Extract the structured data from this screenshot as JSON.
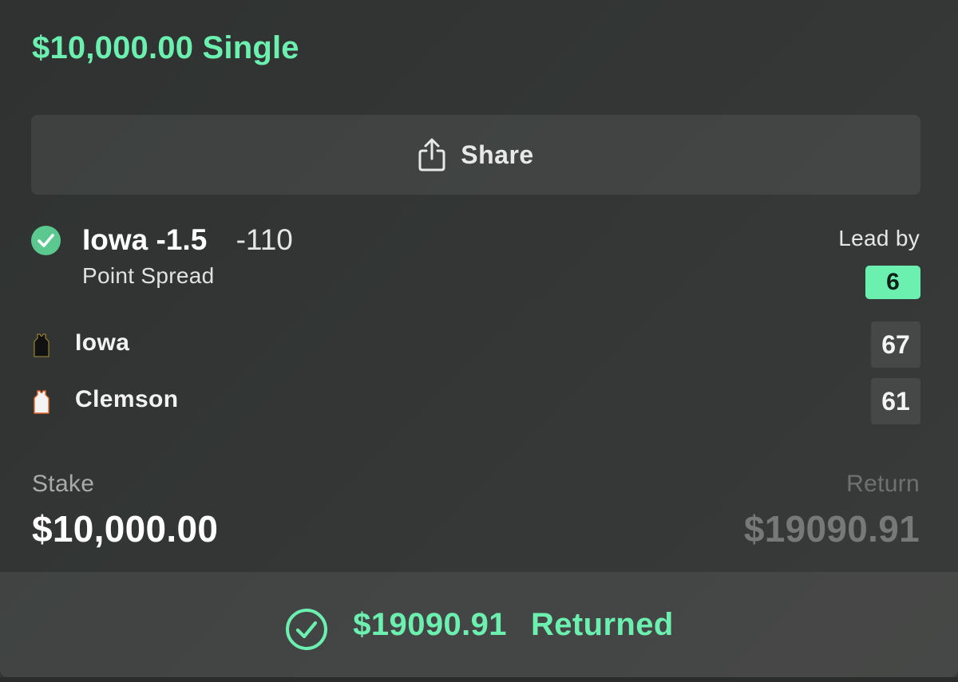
{
  "bet": {
    "title": "$10,000.00 Single",
    "share_label": "Share"
  },
  "selection": {
    "name": "Iowa -1.5",
    "odds": "-110",
    "market": "Point Spread",
    "status": "won"
  },
  "lead": {
    "label": "Lead by",
    "value": "6"
  },
  "teams": [
    {
      "name": "Iowa",
      "score": "67",
      "jersey_color": "#111111",
      "jersey_trim": "#d4b43a"
    },
    {
      "name": "Clemson",
      "score": "61",
      "jersey_color": "#f3f3f3",
      "jersey_trim": "#e06a2c"
    }
  ],
  "stake": {
    "label": "Stake",
    "value": "$10,000.00"
  },
  "return": {
    "label": "Return",
    "value": "$19090.91"
  },
  "returned": {
    "amount": "$19090.91",
    "label": "Returned"
  },
  "colors": {
    "accent": "#6bf0b0",
    "background": "#323534",
    "win_icon": "#5bc98f"
  },
  "icons": {
    "share": "share-icon",
    "selection_status": "check-circle-icon",
    "returned": "check-circle-outline-icon",
    "team": "jersey-icon"
  }
}
